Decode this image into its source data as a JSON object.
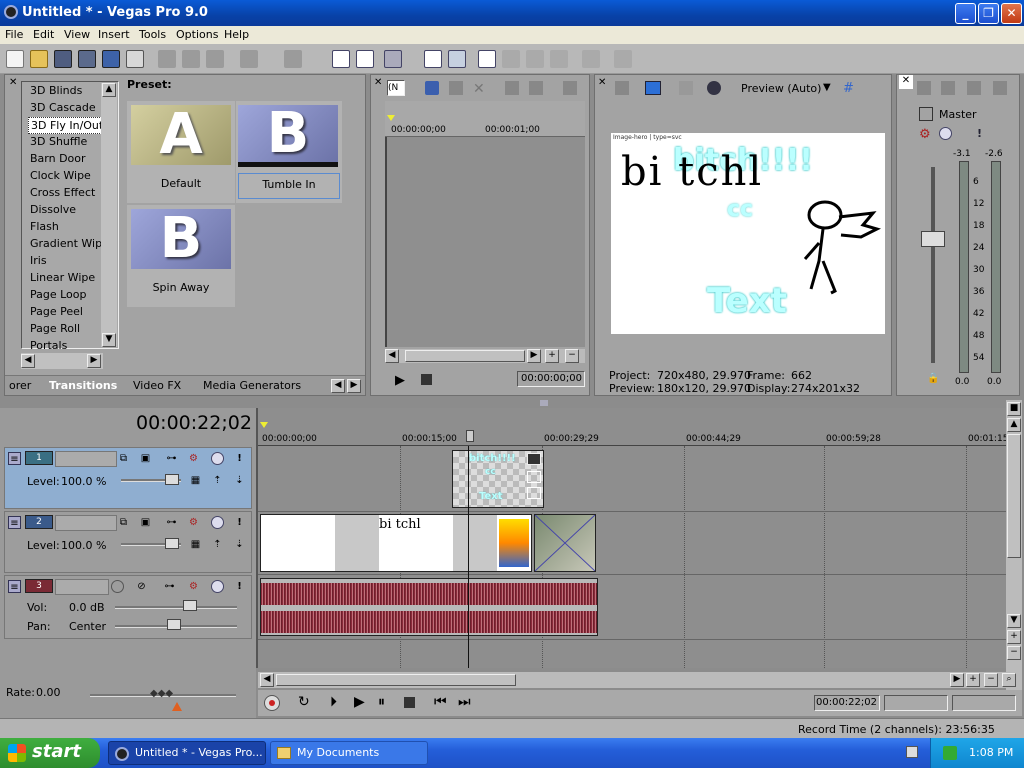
{
  "window": {
    "title": "Untitled * - Vegas Pro 9.0",
    "minimize": "_",
    "maximize": "❐",
    "close": "✕"
  },
  "menu": [
    "File",
    "Edit",
    "View",
    "Insert",
    "Tools",
    "Options",
    "Help"
  ],
  "transitions": {
    "list": [
      "3D Blinds",
      "3D Cascade",
      "3D Fly In/Out",
      "3D Shuffle",
      "Barn Door",
      "Clock Wipe",
      "Cross Effect",
      "Dissolve",
      "Flash",
      "Gradient Wipe",
      "Iris",
      "Linear Wipe",
      "Page Loop",
      "Page Peel",
      "Page Roll",
      "Portals"
    ],
    "selected_index": 2,
    "preset_label": "Preset:",
    "presets": [
      {
        "letter": "A",
        "name": "Default"
      },
      {
        "letter": "B",
        "name": "Tumble In"
      },
      {
        "letter": "B",
        "name": "Spin Away"
      }
    ],
    "tabs": [
      "orer",
      "Transitions",
      "Video FX",
      "Media Generators"
    ]
  },
  "trimmer": {
    "dropdown": "(N",
    "ruler": [
      "00:00:00;00",
      "00:00:01;00"
    ],
    "timecode": "00:00:00;00"
  },
  "preview": {
    "mode": "Preview (Auto)",
    "frame_caption": "Image-hero | type=svc",
    "frame_text_main": "bitch!!!!",
    "frame_text_sub": "cc",
    "frame_text_text": "Text",
    "frame_scribble": "bi tchl",
    "project_label": "Project:",
    "project_value": "720x480, 29.970",
    "frame_label": "Frame:",
    "frame_value": "662",
    "preview_label": "Preview:",
    "preview_value": "180x120, 29.970",
    "display_label": "Display:",
    "display_value": "274x201x32"
  },
  "master": {
    "label": "Master",
    "left_peak": "-3.1",
    "right_peak": "-2.6",
    "scale": [
      "6",
      "12",
      "18",
      "24",
      "30",
      "36",
      "42",
      "48",
      "54"
    ],
    "left_value": "0.0",
    "right_value": "0.0"
  },
  "timeline": {
    "cursor_time": "00:00:22;02",
    "ruler": [
      "00:00:00;00",
      "00:00:15;00",
      "00:00:29;29",
      "00:00:44;29",
      "00:00:59;28",
      "00:01:15"
    ],
    "tracks": [
      {
        "number": "1",
        "kind": "video",
        "level_label": "Level:",
        "level": "100.0 %",
        "color": "#3a6f83"
      },
      {
        "number": "2",
        "kind": "video",
        "level_label": "Level:",
        "level": "100.0 %",
        "color": "#3a5a8a"
      },
      {
        "number": "3",
        "kind": "audio",
        "vol_label": "Vol:",
        "vol": "0.0 dB",
        "pan_label": "Pan:",
        "pan": "Center",
        "color": "#7a2a35"
      }
    ],
    "rate_label": "Rate:",
    "rate": "0.00",
    "transport_time": "00:00:22;02",
    "clip_text": "bitch!!!!",
    "clip_sub": "cc",
    "clip_text2": "Text"
  },
  "status": {
    "record_time": "Record Time (2 channels): 23:56:35"
  },
  "taskbar": {
    "start": "start",
    "tasks": [
      "Untitled * - Vegas Pro...",
      "My Documents"
    ],
    "clock": "1:08 PM"
  }
}
